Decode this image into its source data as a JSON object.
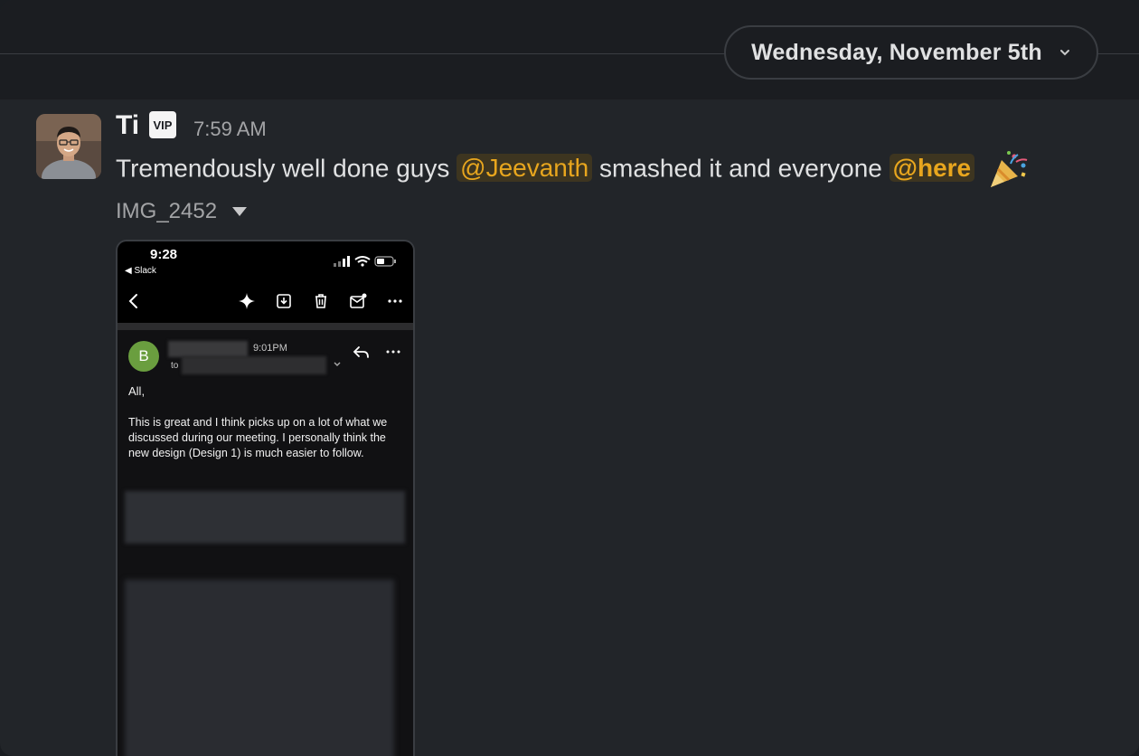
{
  "header": {
    "date_label": "Wednesday, November 5th"
  },
  "message": {
    "sender": "Ti",
    "badge": "VIP",
    "time": "7:59 AM",
    "text_part1": "Tremendously well done guys",
    "mention_1": "@Jeevanth",
    "text_part2": "smashed it and everyone",
    "mention_2": "@here",
    "emoji": "party-popper-icon",
    "attachment": {
      "file_name": "IMG_2452"
    }
  },
  "screenshot": {
    "status_time": "9:28",
    "back_label": "◀ Slack",
    "email": {
      "avatar_letter": "B",
      "time": "9:01PM",
      "to_label": "to",
      "greeting": "All,",
      "body": "This is great and I think picks up on a lot of what we discussed during our meeting. I personally think the new design (Design 1) is much easier to follow."
    }
  },
  "colors": {
    "background": "#222529",
    "mention_bg": "#3d3520",
    "mention_fg": "#e8a61e",
    "avatar_green": "#6a9e3f"
  }
}
